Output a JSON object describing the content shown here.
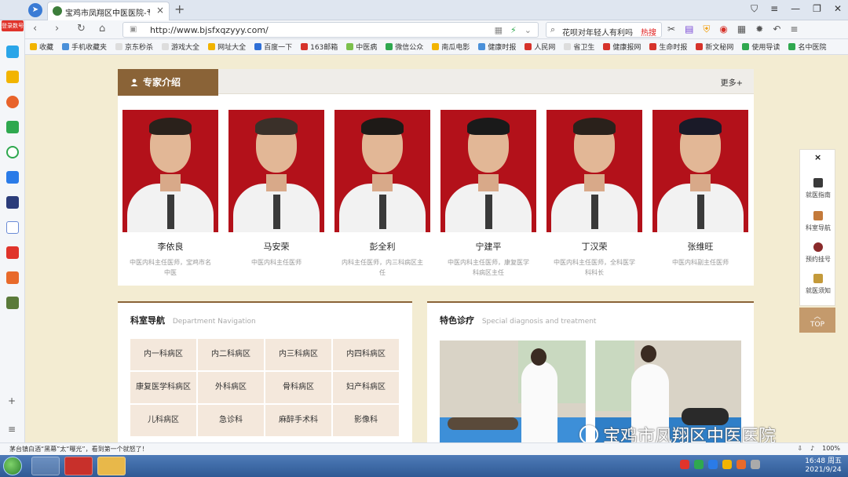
{
  "browser": {
    "tab_title": "宝鸡市凤翔区中医医院-专科特色",
    "tab_close": "×",
    "new_tab": "+",
    "url": "http://www.bjsfxqzyyy.com/",
    "search_text": "花呗对年轻人有利吗",
    "search_hot": "热搜",
    "login_badge": "登录数号"
  },
  "bookmarks": [
    {
      "label": "收藏",
      "color": "#f2b400"
    },
    {
      "label": "手机收藏夹",
      "color": "#4a90d9"
    },
    {
      "label": "京东秒杀",
      "color": "#ddd"
    },
    {
      "label": "游戏大全",
      "color": "#ddd"
    },
    {
      "label": "网址大全",
      "color": "#f2b400"
    },
    {
      "label": "百度一下",
      "color": "#2f6fd6"
    },
    {
      "label": "163邮箱",
      "color": "#d6332b"
    },
    {
      "label": "中医病",
      "color": "#7cc04c"
    },
    {
      "label": "微信公众",
      "color": "#2fa84f"
    },
    {
      "label": "南瓜电影",
      "color": "#f2b400"
    },
    {
      "label": "健康时报",
      "color": "#4a90d9"
    },
    {
      "label": "人民网",
      "color": "#d6332b"
    },
    {
      "label": "省卫生",
      "color": "#ddd"
    },
    {
      "label": "健康报网",
      "color": "#d6332b"
    },
    {
      "label": "生命时报",
      "color": "#d6332b"
    },
    {
      "label": "新文秘网",
      "color": "#d6332b"
    },
    {
      "label": "使用导读",
      "color": "#2fa84f"
    },
    {
      "label": "名中医院",
      "color": "#2fa84f"
    }
  ],
  "experts": {
    "section_title": "专家介绍",
    "more": "更多+",
    "doctors": [
      {
        "name": "李依良",
        "title": "中医内科主任医师，宝鸡市名中医"
      },
      {
        "name": "马安荣",
        "title": "中医内科主任医师"
      },
      {
        "name": "彭全利",
        "title": "内科主任医师，内三科病区主任"
      },
      {
        "name": "宁建平",
        "title": "中医内科主任医师，康复医学科病区主任"
      },
      {
        "name": "丁汉荣",
        "title": "中医内科主任医师，全科医学科科长"
      },
      {
        "name": "张维旺",
        "title": "中医内科副主任医师"
      }
    ]
  },
  "departments": {
    "title": "科室导航",
    "subtitle": "Department Navigation",
    "items": [
      "内一科病区",
      "内二科病区",
      "内三科病区",
      "内四科病区",
      "康复医学科病区",
      "外科病区",
      "骨科病区",
      "妇产科病区",
      "儿科病区",
      "急诊科",
      "麻醉手术科",
      "影像科"
    ]
  },
  "special": {
    "title": "特色诊疗",
    "subtitle": "Special diagnosis and treatment"
  },
  "float_nav": {
    "close": "×",
    "items": [
      "就医指南",
      "科室导航",
      "预约挂号",
      "就医须知"
    ],
    "top": "TOP"
  },
  "watermark": "宝鸡市凤翔区中医医院",
  "status": {
    "news": "茅台镇白酒“黑幕”太“曝光”，看到第一个就怒了！",
    "zoom": "100%"
  },
  "taskbar": {
    "time": "16:48 周五",
    "date": "2021/9/24"
  },
  "colors": {
    "accent": "#8a6337",
    "photo_bg": "#b3111a",
    "page_bg": "#f3ecd2"
  }
}
